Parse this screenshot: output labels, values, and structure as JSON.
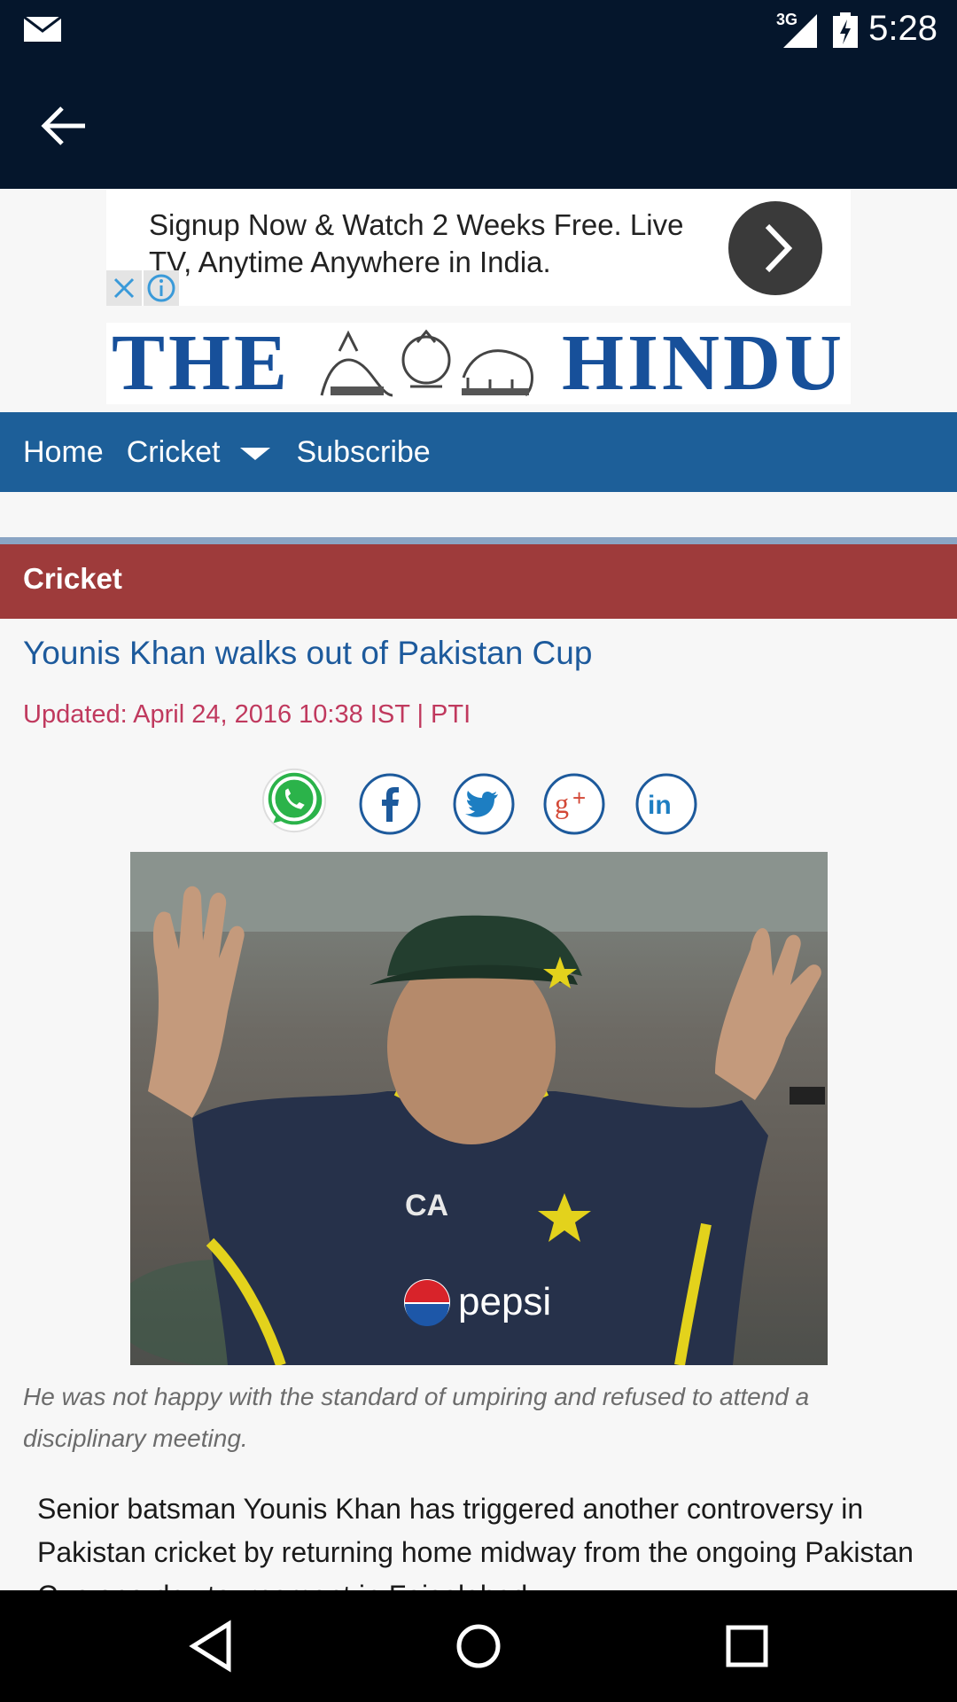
{
  "status_bar": {
    "network": "3G",
    "time": "5:28",
    "icons": [
      "mail-icon",
      "signal-icon",
      "battery-charging-icon"
    ]
  },
  "app_bar": {
    "back_icon": "arrow-left-icon"
  },
  "ad": {
    "text": "Signup Now & Watch 2 Weeks Free. Live TV, Anytime Anywhere in India.",
    "icons": [
      "chevron-right-icon",
      "close-icon",
      "info-icon"
    ]
  },
  "masthead": {
    "word1": "THE",
    "word2": "HINDU"
  },
  "nav": {
    "items": [
      {
        "label": "Home"
      },
      {
        "label": "Cricket"
      },
      {
        "label": "Subscribe"
      }
    ]
  },
  "section": {
    "label": "Cricket"
  },
  "article": {
    "headline": "Younis Khan walks out of Pakistan Cup",
    "updated": "Updated: April 24, 2016 10:38 IST | PTI",
    "share_icons": [
      "whatsapp-icon",
      "facebook-icon",
      "twitter-icon",
      "google-plus-icon",
      "linkedin-icon"
    ],
    "photo_text": "pepsi",
    "caption": "He was not happy with the standard of umpiring and refused to attend a disciplinary meeting.",
    "body": "Senior batsman Younis Khan has triggered another controversy in Pakistan cricket by returning home midway from the ongoing Pakistan Cup one-day tournament in Faisalabad."
  },
  "colors": {
    "status_bg": "#05162c",
    "nav_bg": "#1d5f99",
    "section_bg": "#9e3b3b",
    "headline": "#1d5a9c",
    "updated": "#c0395e",
    "masthead": "#17509a"
  }
}
